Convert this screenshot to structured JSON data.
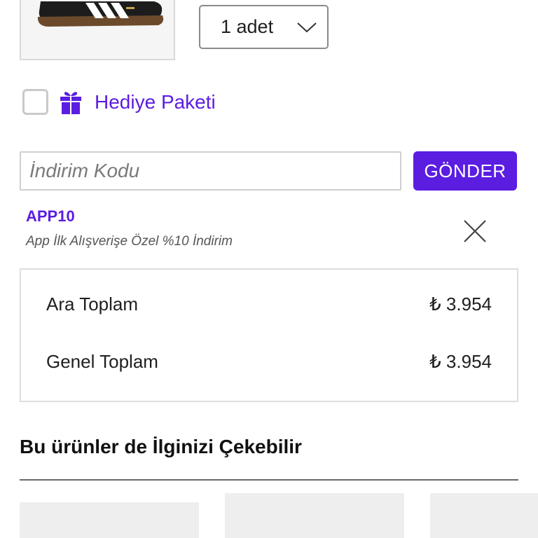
{
  "product": {
    "thumbnail_icon": "sneaker-thumbnail",
    "quantity_value": "1 adet"
  },
  "gift": {
    "checked": false,
    "icon": "gift-icon",
    "label": "Hediye Paketi"
  },
  "coupon": {
    "placeholder": "İndirim Kodu",
    "value": "",
    "submit_label": "GÖNDER",
    "applied_code": "APP10",
    "applied_description": "App İlk Alışverişe Özel %10 İndirim"
  },
  "totals": {
    "subtotal_label": "Ara Toplam",
    "subtotal_value": "₺ 3.954",
    "grand_label": "Genel Toplam",
    "grand_value": "₺ 3.954"
  },
  "recommendations": {
    "title": "Bu ürünler de İlginizi Çekebilir"
  },
  "colors": {
    "accent": "#5b1de0",
    "border": "#d9d9d9",
    "placeholder_card": "#eeeeee"
  }
}
